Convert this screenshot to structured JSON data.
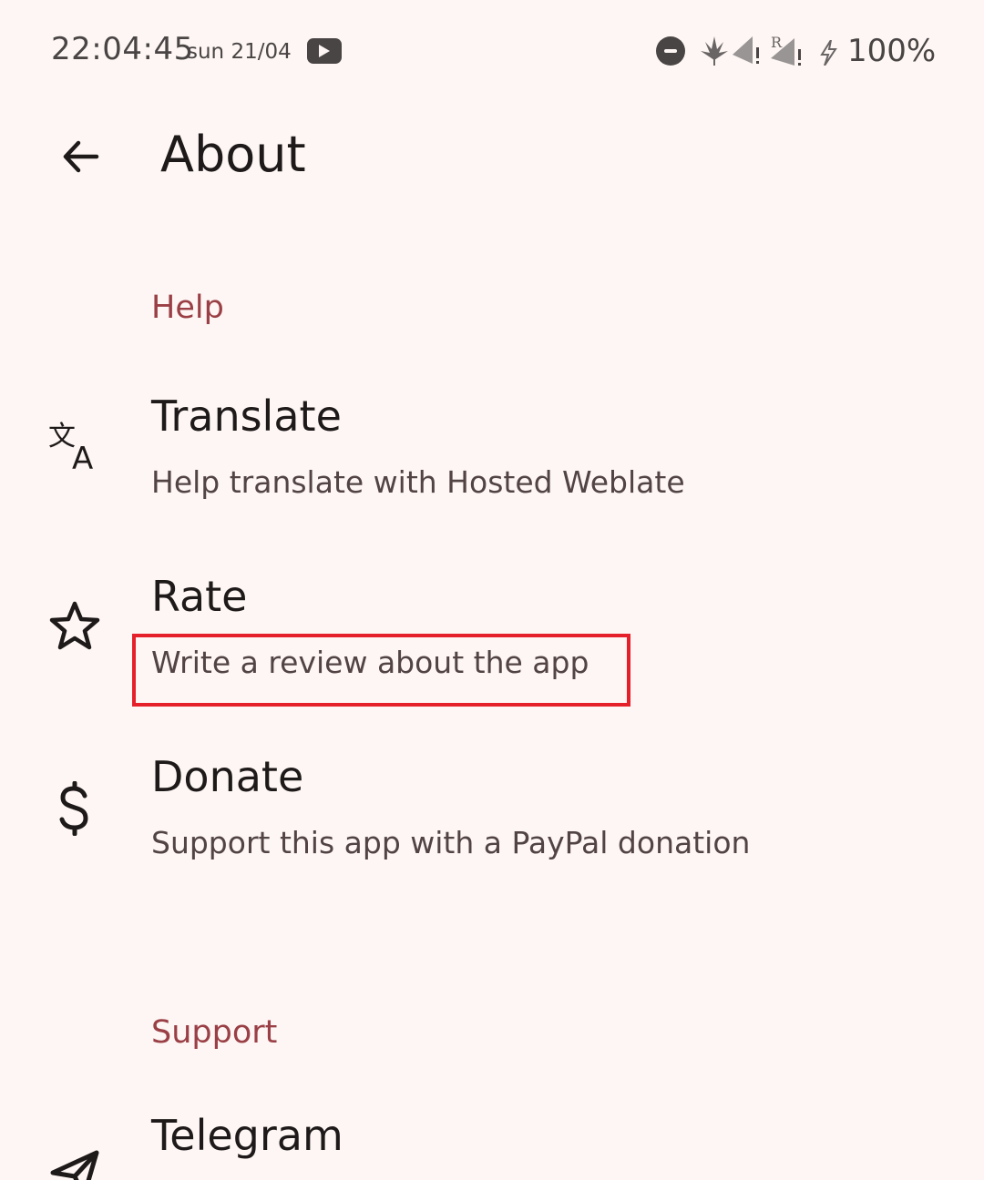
{
  "status_bar": {
    "time": "22:04:45",
    "date": "sun 21/04",
    "battery": "100%",
    "icons": [
      "youtube-icon",
      "dnd-icon",
      "cannabis-icon",
      "signal-alert-icon",
      "roaming-signal-alert-icon",
      "charging-bolt-icon"
    ]
  },
  "app_bar": {
    "title": "About"
  },
  "sections": {
    "help": {
      "header": "Help",
      "items": [
        {
          "title": "Translate",
          "subtitle": "Help translate with Hosted Weblate",
          "icon": "translate-icon"
        },
        {
          "title": "Rate",
          "subtitle": "Write a review about the app",
          "icon": "star-icon"
        },
        {
          "title": "Donate",
          "subtitle": "Support this app with a PayPal donation",
          "icon": "dollar-icon"
        }
      ]
    },
    "support": {
      "header": "Support",
      "items": [
        {
          "title": "Telegram",
          "icon": "send-icon"
        }
      ]
    }
  },
  "colors": {
    "background": "#fdf6f4",
    "accent": "#9a3f45",
    "highlight": "#e5202a"
  }
}
